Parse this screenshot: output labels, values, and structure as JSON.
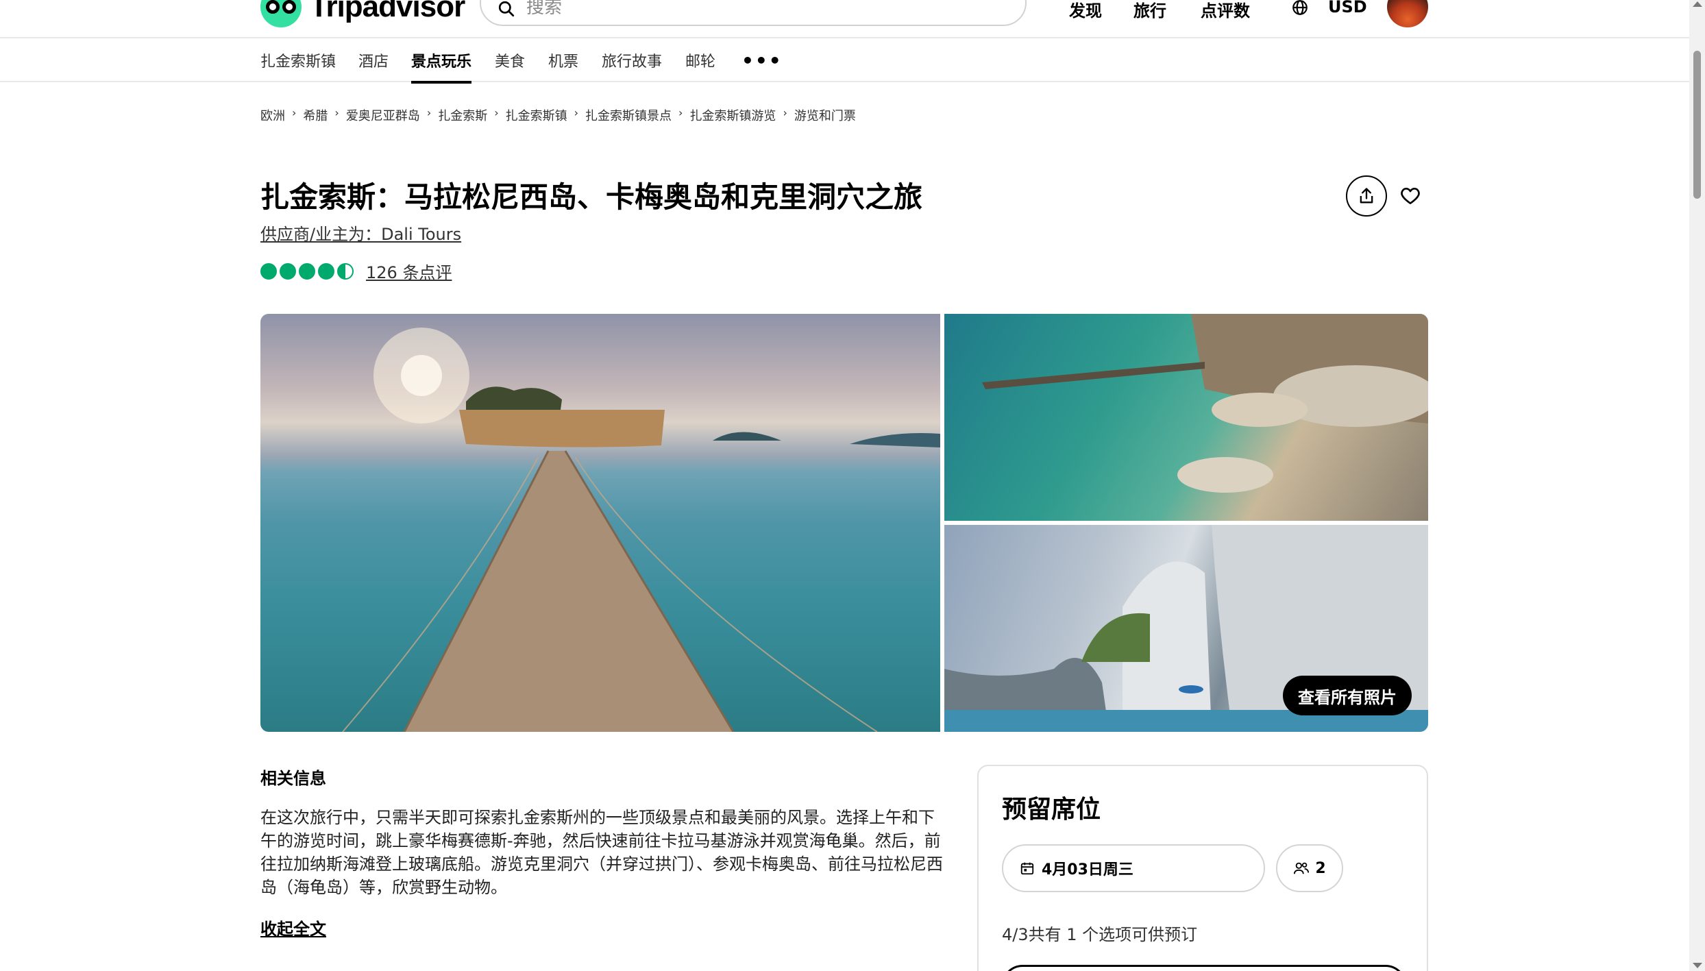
{
  "header": {
    "logo_text": "Tripadvisor",
    "search_placeholder": "搜索",
    "nav": [
      "发现",
      "旅行",
      "点评数"
    ],
    "currency": "USD"
  },
  "sub_nav": {
    "tabs": [
      "扎金索斯镇",
      "酒店",
      "景点玩乐",
      "美食",
      "机票",
      "旅行故事",
      "邮轮"
    ],
    "active_tab": "景点玩乐",
    "more": "•••"
  },
  "breadcrumb": [
    "欧洲",
    "希腊",
    "爱奥尼亚群岛",
    "扎金索斯",
    "扎金索斯镇",
    "扎金索斯镇景点",
    "扎金索斯镇游览",
    "游览和门票"
  ],
  "product": {
    "title": "扎金索斯：马拉松尼西岛、卡梅奥岛和克里洞穴之旅",
    "provider": "供应商/业主为：Dali Tours",
    "rating": 4.5,
    "review_count": "126 条点评"
  },
  "gallery": {
    "see_all": "查看所有照片"
  },
  "about": {
    "heading": "相关信息",
    "text": "在这次旅行中，只需半天即可探索扎金索斯州的一些顶级景点和最美丽的风景。选择上午和下午的游览时间，跳上豪华梅赛德斯-奔驰，然后快速前往卡拉马基游泳并观赏海龟巢。然后，前往拉加纳斯海滩登上玻璃底船。游览克里洞穴（并穿过拱门）、参观卡梅奥岛、前往马拉松尼西岛（海龟岛）等，欣赏野生动物。",
    "collapse": "收起全文"
  },
  "booking": {
    "title": "预留席位",
    "date": "4月03日周三",
    "people": "2",
    "availability": "4/3共有 1 个选项可供预订"
  },
  "colors": {
    "brand": "#34e0a1",
    "rating": "#00aa6c"
  }
}
